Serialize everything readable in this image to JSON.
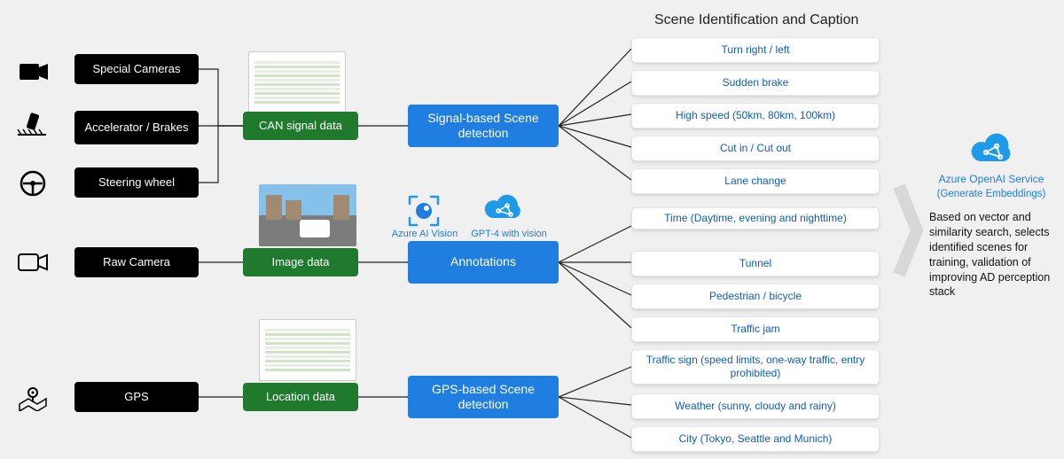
{
  "inputs": {
    "special_cameras": "Special Cameras",
    "accel_brakes": "Accelerator / Brakes",
    "steering_wheel": "Steering wheel",
    "raw_camera": "Raw Camera",
    "gps": "GPS"
  },
  "data_nodes": {
    "can": "CAN signal data",
    "image": "Image data",
    "location": "Location data"
  },
  "process_nodes": {
    "signal_scene": "Signal-based Scene detection",
    "annotations": "Annotations",
    "gps_scene": "GPS-based Scene detection"
  },
  "vision_labels": {
    "azure_ai_vision": "Azure AI Vision",
    "gpt4v": "GPT-4 with vision"
  },
  "scene_header": "Scene Identification and Caption",
  "scenes": [
    "Turn right / left",
    "Sudden brake",
    "High speed (50km, 80km, 100km)",
    "Cut in / Cut out",
    "Lane change",
    "Time (Daytime, evening and nighttime)",
    "Tunnel",
    "Pedestrian / bicycle",
    "Traffic jam",
    "Traffic sign (speed limits, one-way traffic, entry prohibited)",
    "Weather (sunny, cloudy and rainy)",
    "City (Tokyo, Seattle and Munich)"
  ],
  "output": {
    "service_name": "Azure OpenAI Service",
    "service_sub": "(Generate Embeddings)",
    "description": "Based on vector and similarity search, selects identified scenes for training, validation of improving AD perception stack"
  }
}
